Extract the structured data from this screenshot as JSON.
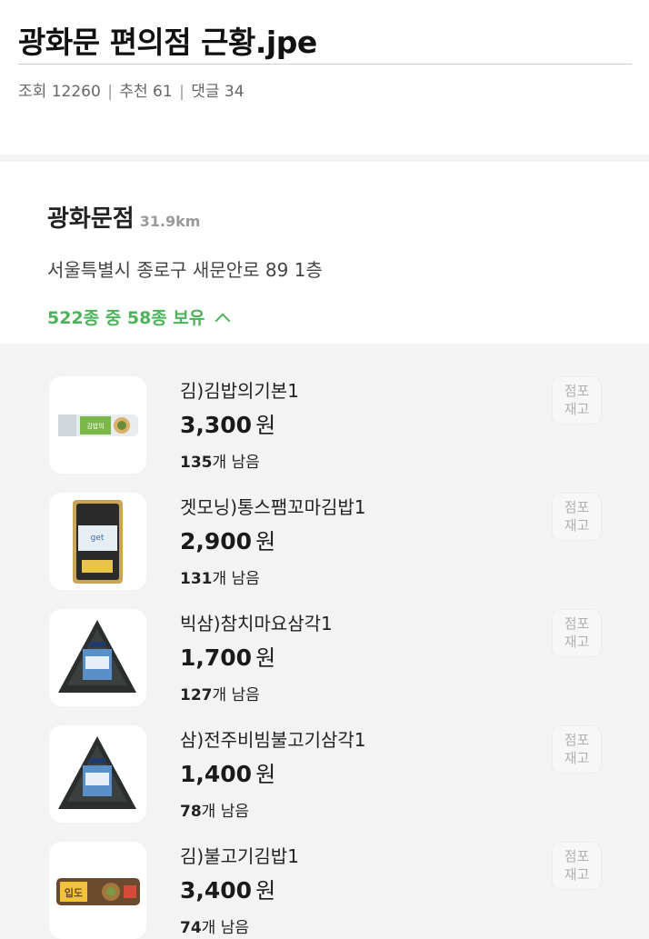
{
  "post": {
    "title": "광화문 편의점 근황.jpe",
    "views_label": "조회",
    "views": "12260",
    "recommend_label": "추천",
    "recommend": "61",
    "comments_label": "댓글",
    "comments": "34"
  },
  "store": {
    "name": "광화문점",
    "distance": "31.9km",
    "address": "서울특별시 종로구 새문안로 89 1층",
    "stock_summary": "522종 중 58종 보유"
  },
  "products": [
    {
      "name": "김)김밥의기본1",
      "price": "3,300",
      "unit": "원",
      "remaining": "135",
      "remaining_suffix": "개 남음",
      "button": "점포\n재고",
      "thumb_icon": "gimbap-icon"
    },
    {
      "name": "겟모닝)통스팸꼬마김밥1",
      "price": "2,900",
      "unit": "원",
      "remaining": "131",
      "remaining_suffix": "개 남음",
      "button": "점포\n재고",
      "thumb_icon": "mini-gimbap-box-icon"
    },
    {
      "name": "빅삼)참치마요삼각1",
      "price": "1,700",
      "unit": "원",
      "remaining": "127",
      "remaining_suffix": "개 남음",
      "button": "점포\n재고",
      "thumb_icon": "triangle-kimbap-icon"
    },
    {
      "name": "삼)전주비빔불고기삼각1",
      "price": "1,400",
      "unit": "원",
      "remaining": "78",
      "remaining_suffix": "개 남음",
      "button": "점포\n재고",
      "thumb_icon": "triangle-kimbap-icon"
    },
    {
      "name": "김)불고기김밥1",
      "price": "3,400",
      "unit": "원",
      "remaining": "74",
      "remaining_suffix": "개 남음",
      "button": "점포\n재고",
      "thumb_icon": "bulgogi-gimbap-icon"
    }
  ],
  "colors": {
    "accent_green": "#4cb35a",
    "list_background": "#f3f3f3"
  }
}
